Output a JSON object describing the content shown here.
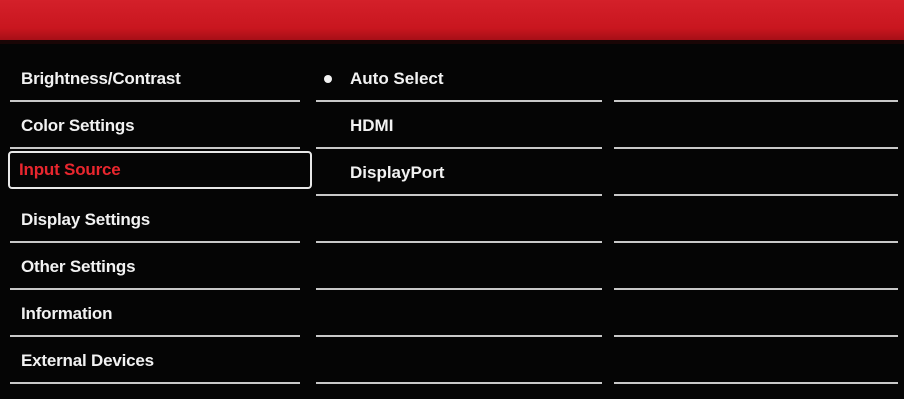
{
  "menu": {
    "items": [
      {
        "label": "Brightness/Contrast"
      },
      {
        "label": "Color Settings"
      },
      {
        "label": "Input Source"
      },
      {
        "label": "Display Settings"
      },
      {
        "label": "Other Settings"
      },
      {
        "label": "Information"
      },
      {
        "label": "External Devices"
      }
    ],
    "selected_index": 2
  },
  "options": {
    "items": [
      {
        "label": "Auto Select",
        "selected": true
      },
      {
        "label": "HDMI",
        "selected": false
      },
      {
        "label": "DisplayPort",
        "selected": false
      },
      {
        "label": ""
      },
      {
        "label": ""
      },
      {
        "label": ""
      },
      {
        "label": ""
      }
    ]
  },
  "submenu": {
    "items": [
      "",
      "",
      "",
      "",
      "",
      "",
      ""
    ]
  },
  "colors": {
    "header": "#d4202a",
    "selected_text": "#e8262e",
    "text": "#f2f2f2",
    "background": "#050505"
  }
}
